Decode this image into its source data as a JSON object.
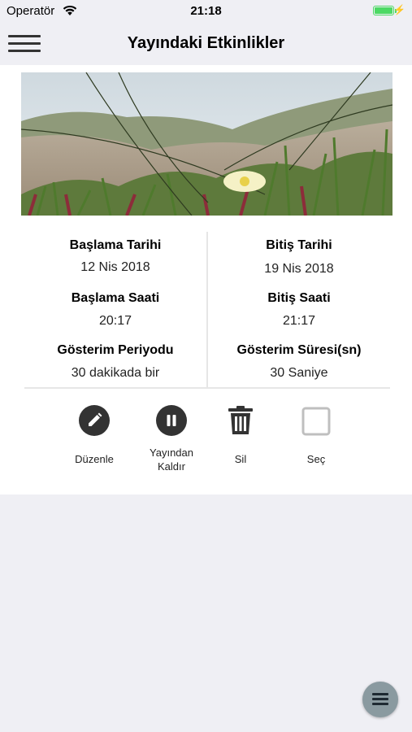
{
  "status": {
    "carrier": "Operatör",
    "time": "21:18"
  },
  "nav": {
    "title": "Yayındaki Etkinlikler"
  },
  "details": {
    "start_date_label": "Başlama Tarihi",
    "start_date": "12 Nis 2018",
    "end_date_label": "Bitiş Tarihi",
    "end_date": "19 Nis 2018",
    "start_time_label": "Başlama Saati",
    "start_time": "20:17",
    "end_time_label": "Bitiş Saati",
    "end_time": "21:17",
    "period_label": "Gösterim Periyodu",
    "period": "30 dakikada bir",
    "duration_label": "Gösterim Süresi(sn)",
    "duration": "30 Saniye"
  },
  "actions": {
    "edit": "Düzenle",
    "unpublish_line1": "Yayından",
    "unpublish_line2": "Kaldır",
    "delete": "Sil",
    "select": "Seç"
  },
  "colors": {
    "battery": "#4cd964",
    "icon": "#333333",
    "fab": "#8a9aa0"
  }
}
